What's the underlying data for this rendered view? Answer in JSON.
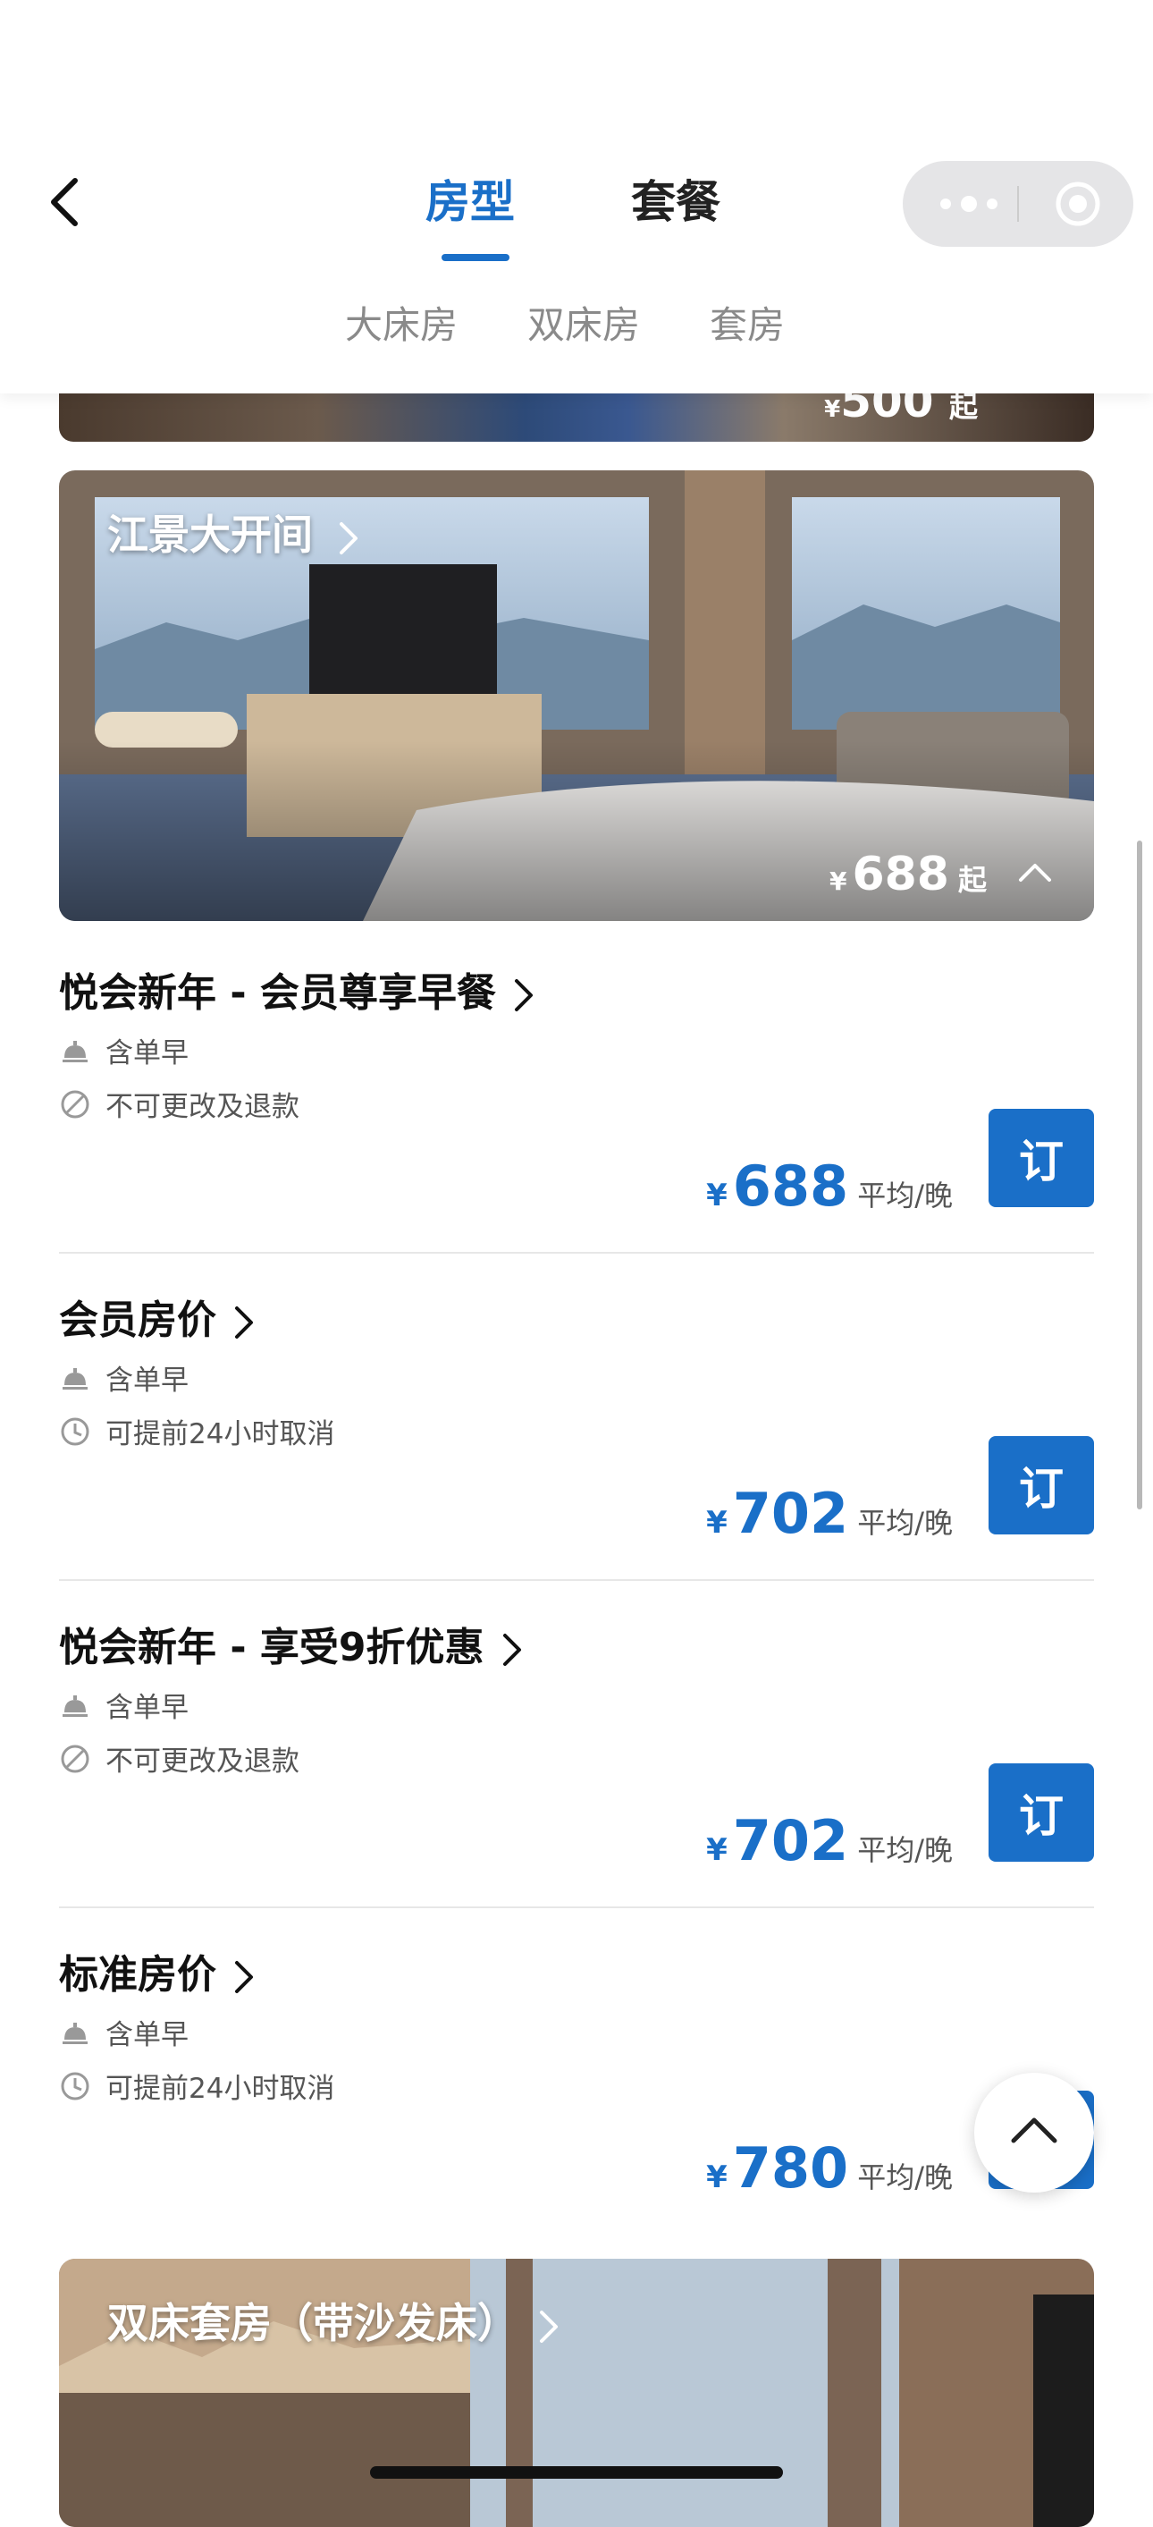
{
  "header": {
    "tabs": [
      {
        "label": "房型",
        "active": true
      },
      {
        "label": "套餐",
        "active": false
      }
    ],
    "subtabs": [
      "大床房",
      "双床房",
      "套房"
    ],
    "accent": "#1a6fc8"
  },
  "prev_room": {
    "currency": "¥",
    "price": "500",
    "suffix": "起"
  },
  "room": {
    "title": "江景大开间",
    "currency": "¥",
    "price": "688",
    "suffix": "起"
  },
  "rates": [
    {
      "title": "悦会新年 - 会员尊享早餐",
      "breakfast": "含单早",
      "policy": "不可更改及退款",
      "policy_icon": "no-refund-icon",
      "currency": "¥",
      "price": "688",
      "per": "平均/晚",
      "book": "订"
    },
    {
      "title": "会员房价",
      "breakfast": "含单早",
      "policy": "可提前24小时取消",
      "policy_icon": "clock-icon",
      "currency": "¥",
      "price": "702",
      "per": "平均/晚",
      "book": "订"
    },
    {
      "title": "悦会新年 - 享受9折优惠",
      "breakfast": "含单早",
      "policy": "不可更改及退款",
      "policy_icon": "no-refund-icon",
      "currency": "¥",
      "price": "702",
      "per": "平均/晚",
      "book": "订"
    },
    {
      "title": "标准房价",
      "breakfast": "含单早",
      "policy": "可提前24小时取消",
      "policy_icon": "clock-icon",
      "currency": "¥",
      "price": "780",
      "per": "平均/晚",
      "book": "订"
    }
  ],
  "next_room": {
    "title": "双床套房（带沙发床）"
  }
}
